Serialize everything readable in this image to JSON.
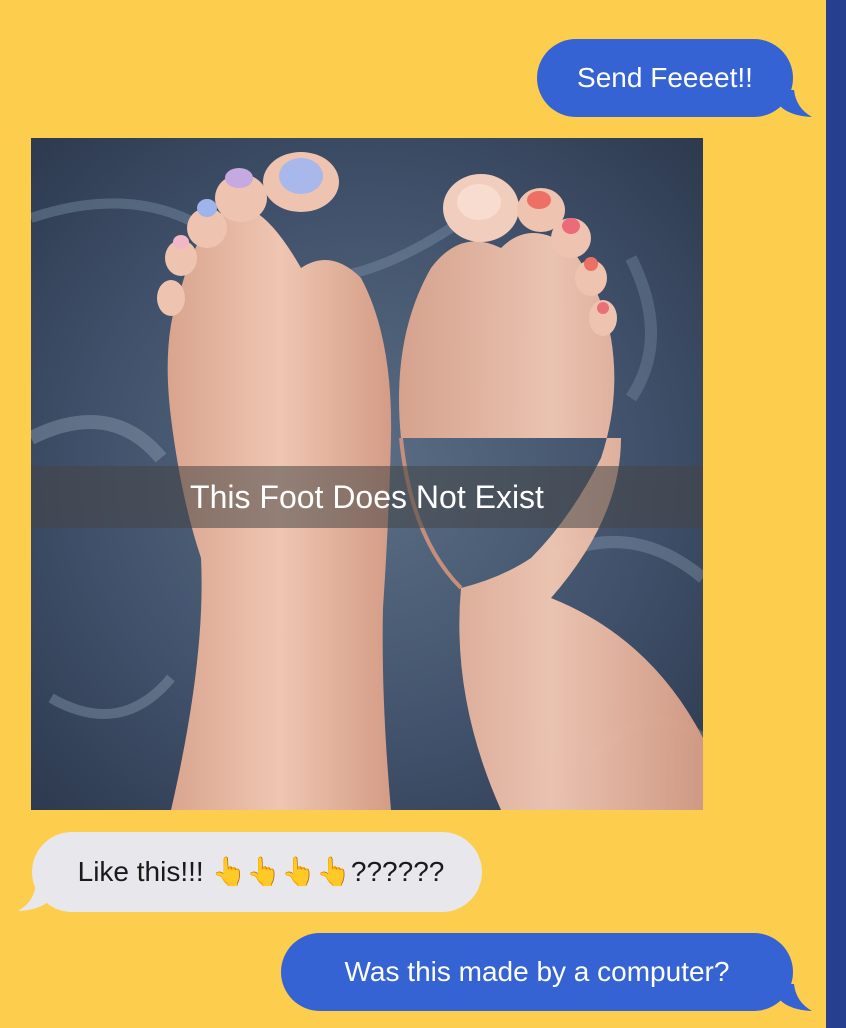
{
  "messages": [
    {
      "sender": "me",
      "text": "Send Feeeet!!"
    },
    {
      "sender": "them",
      "text": "Like this!!! 👆👆👆👆??????"
    },
    {
      "sender": "me",
      "text": "Was this made by a computer?"
    }
  ],
  "photo": {
    "caption": "This Foot Does Not Exist"
  },
  "colors": {
    "background": "#fdcd4e",
    "sent_bubble": "#3563d3",
    "received_bubble": "#e8e8ec",
    "stripe": "#273f8f"
  }
}
